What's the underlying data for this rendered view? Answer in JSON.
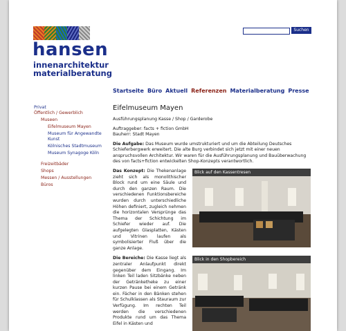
{
  "brand": {
    "name": "hansen",
    "tagline_line1": "innenarchitektur",
    "tagline_line2": "materialberatung"
  },
  "search": {
    "placeholder": "",
    "button": "Suchen"
  },
  "topnav": [
    "Startseite",
    "Büro",
    "Aktuell",
    "Referenzen",
    "Materialberatung",
    "Presse"
  ],
  "sidenav": {
    "privat": "Privat",
    "oeffentlich": "Öffentlich / Gewerblich",
    "museen": "Museen",
    "museen_items": [
      "Eifelmuseum Mayen",
      "Museum für Angewandte Kunst",
      "Kölnisches Stadtmuseum",
      "Museum Synagoge Köln"
    ],
    "other": [
      "Freizeitbäder",
      "Shops",
      "Messen / Ausstellungen",
      "Büros"
    ]
  },
  "content": {
    "title": "Eifelmuseum Mayen",
    "subtitle": "Ausführungsplanung Kasse / Shop / Garderobe",
    "client": "Auftraggeber: facts + fiction GmbH",
    "owner": "Bauherr: Stadt Mayen",
    "task_label": "Die Aufgabe:",
    "task_text": "Das Museum wurde umstrukturiert und um die Abteilung Deutsches Schieferbergwerk erweitert. Die alte Burg verbindet sich jetzt mit einer neuen anspruchsvollen Architektur. Wir waren für die Ausführungsplanung und Bauüberwachung des von facts+fiction entwickelten Shop-Konzepts verantwortlich.",
    "concept_label": "Das Konzept:",
    "concept_text": "Die Thekenanlage zieht sich als monolithischer Block rund um eine Säule und durch den ganzen Raum. Die verschiedenen Funktionsbereiche wurden durch unterschiedliche Höhen definiert, zugleich nehmen die horizontalen Versprünge das Thema der Schichtung im Schiefer wieder auf. Die aufgelegten Glasplatten, Kästen und Vitrinen laufen als symbolisierter Fluß über die ganze Anlage.",
    "areas_label": "Die Bereiche:",
    "areas_text": "Die Kasse liegt als zentraler Anlaufpunkt direkt gegenüber dem Eingang. Im linken Teil laden Sitzbänke neben der Getränketheke zu einer kurzen Pause bei einem Getränk ein. Fächer in den Bänken stehen für Schulklassen als Stauraum zur Verfügung. Im rechten Teil werden die verschiedenen Produkte rund um das Thema Eifel in Kästen und"
  },
  "photos": [
    {
      "caption": "Blick auf den Kassentresen"
    },
    {
      "caption": "Blick in den Shopbereich"
    }
  ],
  "colors": {
    "brand_blue": "#1b2f8a",
    "active_red": "#8b2318"
  }
}
